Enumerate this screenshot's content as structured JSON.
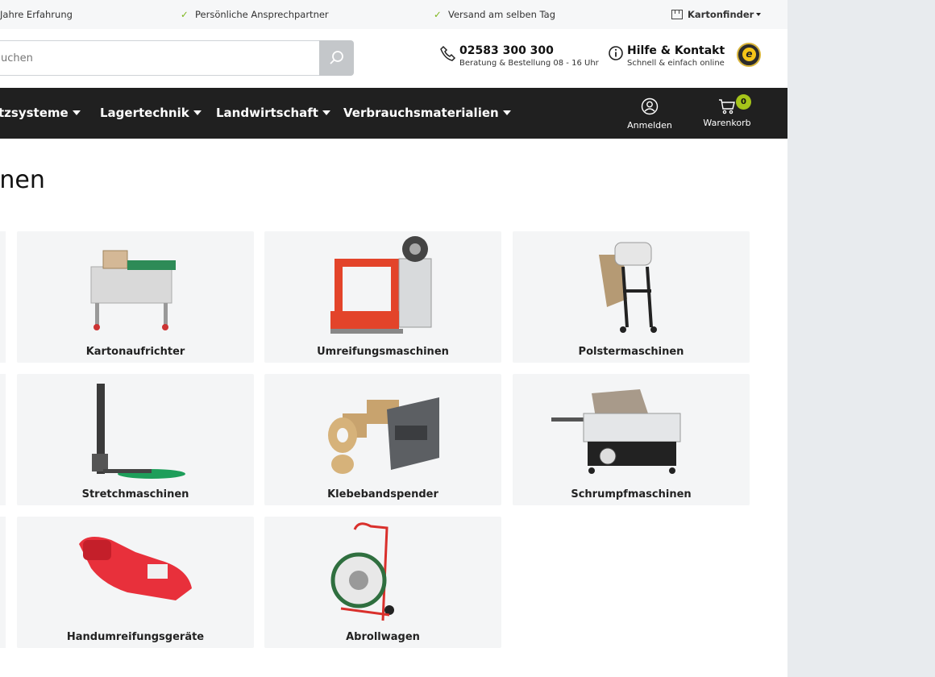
{
  "topbar": {
    "items": [
      "Jahre Erfahrung",
      "Persönliche Ansprechpartner",
      "Versand am selben Tag"
    ],
    "kartonfinder": "Kartonfinder"
  },
  "search": {
    "placeholder": "uchen"
  },
  "contact": {
    "phone": "02583 300 300",
    "phone_sub": "Beratung & Bestellung 08 - 16 Uhr",
    "help": "Hilfe & Kontakt",
    "help_sub": "Schnell & einfach online"
  },
  "trust_badge": "e",
  "nav": {
    "links": [
      "tzsysteme",
      "Lagertechnik",
      "Landwirtschaft",
      "Verbrauchsmaterialien"
    ],
    "login": "Anmelden",
    "cart": "Warenkorb",
    "cart_count": "0"
  },
  "page_title": "hinen",
  "categories": [
    {
      "label": "Kartonaufrichter",
      "icon": "box-erector-machine-icon"
    },
    {
      "label": "Umreifungsmaschinen",
      "icon": "strapping-machine-icon"
    },
    {
      "label": "Polstermaschinen",
      "icon": "cushioning-machine-icon"
    },
    {
      "label": "Stretchmaschinen",
      "icon": "stretch-wrapper-icon"
    },
    {
      "label": "Klebebandspender",
      "icon": "tape-dispenser-icon"
    },
    {
      "label": "Schrumpfmaschinen",
      "icon": "shrink-machine-icon"
    },
    {
      "label": "Handumreifungsgeräte",
      "icon": "hand-strapping-tool-icon"
    },
    {
      "label": "Abrollwagen",
      "icon": "dispenser-cart-icon"
    }
  ],
  "colors": {
    "accent": "#a5c41a",
    "nav_bg": "#202020",
    "check": "#7cb518",
    "card_bg": "#f4f5f6"
  }
}
